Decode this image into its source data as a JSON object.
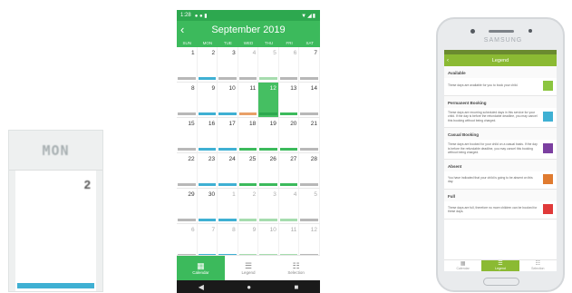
{
  "zoom": {
    "weekday": "MON",
    "day": "2",
    "bar_color": "#3fb0d3"
  },
  "phone": {
    "status_time": "1:28",
    "status_icons_left": "● ● ▮",
    "status_icons_right": "▼◢▮",
    "title": "September 2019",
    "back_icon": "‹",
    "weekdays": [
      "SUN",
      "MON",
      "TUE",
      "WED",
      "THU",
      "FRI",
      "SAT"
    ],
    "colors": {
      "green": "#3cba5c",
      "blue": "#3fb0d3",
      "lightgreen": "#a6dcae",
      "gray": "#b8b8b8",
      "orange": "#e8a068",
      "darkgreen": "#2da84f"
    },
    "weeks": [
      [
        {
          "d": "1",
          "bar": "gray"
        },
        {
          "d": "2",
          "bar": "blue"
        },
        {
          "d": "3",
          "bar": "gray"
        },
        {
          "d": "4",
          "bar": "gray",
          "muted": true
        },
        {
          "d": "5",
          "bar": "lightgreen",
          "muted": true
        },
        {
          "d": "6",
          "bar": "gray",
          "muted": true
        },
        {
          "d": "7",
          "bar": "gray"
        }
      ],
      [
        {
          "d": "8",
          "bar": "gray"
        },
        {
          "d": "9",
          "bar": "blue"
        },
        {
          "d": "10",
          "bar": "blue"
        },
        {
          "d": "11",
          "bar": "orange"
        },
        {
          "d": "12",
          "bar": "green",
          "today": true
        },
        {
          "d": "13",
          "bar": "green"
        },
        {
          "d": "14",
          "bar": "gray"
        }
      ],
      [
        {
          "d": "15",
          "bar": "gray"
        },
        {
          "d": "16",
          "bar": "blue"
        },
        {
          "d": "17",
          "bar": "blue"
        },
        {
          "d": "18",
          "bar": "green"
        },
        {
          "d": "19",
          "bar": "green"
        },
        {
          "d": "20",
          "bar": "green"
        },
        {
          "d": "21",
          "bar": "gray"
        }
      ],
      [
        {
          "d": "22",
          "bar": "gray"
        },
        {
          "d": "23",
          "bar": "blue"
        },
        {
          "d": "24",
          "bar": "blue"
        },
        {
          "d": "25",
          "bar": "green"
        },
        {
          "d": "26",
          "bar": "green"
        },
        {
          "d": "27",
          "bar": "green"
        },
        {
          "d": "28",
          "bar": "gray"
        }
      ],
      [
        {
          "d": "29",
          "bar": "gray"
        },
        {
          "d": "30",
          "bar": "blue"
        },
        {
          "d": "1",
          "bar": "blue",
          "muted": true
        },
        {
          "d": "2",
          "bar": "lightgreen",
          "muted": true
        },
        {
          "d": "3",
          "bar": "lightgreen",
          "muted": true
        },
        {
          "d": "4",
          "bar": "lightgreen",
          "muted": true
        },
        {
          "d": "5",
          "bar": "gray",
          "muted": true
        }
      ],
      [
        {
          "d": "6",
          "bar": "gray",
          "muted": true
        },
        {
          "d": "7",
          "bar": "blue",
          "muted": true
        },
        {
          "d": "8",
          "bar": "blue",
          "muted": true
        },
        {
          "d": "9",
          "bar": "lightgreen",
          "muted": true
        },
        {
          "d": "10",
          "bar": "lightgreen",
          "muted": true
        },
        {
          "d": "11",
          "bar": "lightgreen",
          "muted": true
        },
        {
          "d": "12",
          "bar": "gray",
          "muted": true
        }
      ]
    ],
    "nav": [
      {
        "label": "Calendar",
        "icon": "▦",
        "active": true
      },
      {
        "label": "Legend",
        "icon": "☰",
        "active": false
      },
      {
        "label": "Selection",
        "icon": "☷",
        "active": false
      }
    ],
    "sysnav": [
      "◀",
      "●",
      "■"
    ]
  },
  "samsung": {
    "brand": "SAMSUNG",
    "title": "Legend",
    "back_icon": "‹",
    "sections": [
      {
        "heading": "Available",
        "text": "These days are available for you to book your child.",
        "color": "#8bc53f"
      },
      {
        "heading": "Permanent Booking",
        "text": "These days are recurring scheduled days in this service for your child. If the day is before the refundable deadline, you may cancel this booking without being charged.",
        "color": "#3fb0d3"
      },
      {
        "heading": "Casual Booking",
        "text": "These days are booked for your child on a casual basis. If the day is before the refundable deadline, you may cancel this booking without being charged.",
        "color": "#7b3fa0"
      },
      {
        "heading": "Absent",
        "text": "You have indicated that your child is going to be absent on this day.",
        "color": "#e07b30"
      },
      {
        "heading": "Full",
        "text": "These days are full, therefore no more children can be booked for these days.",
        "color": "#e03a3a"
      }
    ],
    "nav": [
      {
        "label": "Calendar",
        "icon": "▦",
        "active": false
      },
      {
        "label": "Legend",
        "icon": "☰",
        "active": true
      },
      {
        "label": "Selection",
        "icon": "☷",
        "active": false
      }
    ]
  }
}
